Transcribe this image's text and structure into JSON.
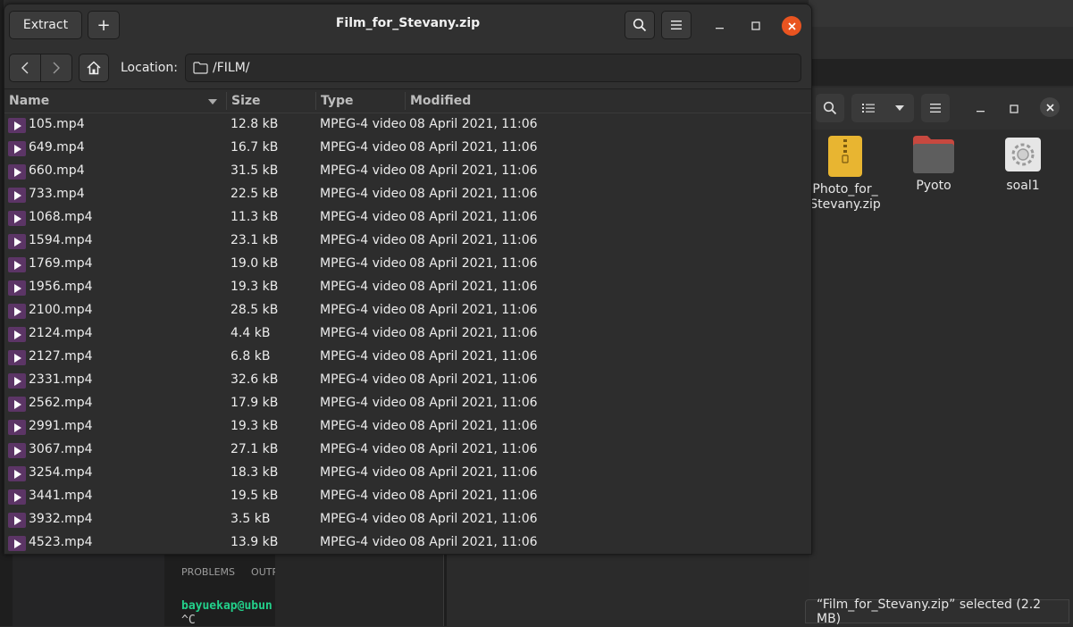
{
  "archive_window": {
    "title": "Film_for_Stevany.zip",
    "extract_label": "Extract",
    "add_label": "+",
    "location_label": "Location:",
    "location_path": "/FILM/",
    "columns": {
      "name": "Name",
      "size": "Size",
      "type": "Type",
      "modified": "Modified"
    },
    "files": [
      {
        "name": "105.mp4",
        "size": "12.8 kB",
        "type": "MPEG-4 video",
        "modified": "08 April 2021, 11:06"
      },
      {
        "name": "649.mp4",
        "size": "16.7 kB",
        "type": "MPEG-4 video",
        "modified": "08 April 2021, 11:06"
      },
      {
        "name": "660.mp4",
        "size": "31.5 kB",
        "type": "MPEG-4 video",
        "modified": "08 April 2021, 11:06"
      },
      {
        "name": "733.mp4",
        "size": "22.5 kB",
        "type": "MPEG-4 video",
        "modified": "08 April 2021, 11:06"
      },
      {
        "name": "1068.mp4",
        "size": "11.3 kB",
        "type": "MPEG-4 video",
        "modified": "08 April 2021, 11:06"
      },
      {
        "name": "1594.mp4",
        "size": "23.1 kB",
        "type": "MPEG-4 video",
        "modified": "08 April 2021, 11:06"
      },
      {
        "name": "1769.mp4",
        "size": "19.0 kB",
        "type": "MPEG-4 video",
        "modified": "08 April 2021, 11:06"
      },
      {
        "name": "1956.mp4",
        "size": "19.3 kB",
        "type": "MPEG-4 video",
        "modified": "08 April 2021, 11:06"
      },
      {
        "name": "2100.mp4",
        "size": "28.5 kB",
        "type": "MPEG-4 video",
        "modified": "08 April 2021, 11:06"
      },
      {
        "name": "2124.mp4",
        "size": "4.4 kB",
        "type": "MPEG-4 video",
        "modified": "08 April 2021, 11:06"
      },
      {
        "name": "2127.mp4",
        "size": "6.8 kB",
        "type": "MPEG-4 video",
        "modified": "08 April 2021, 11:06"
      },
      {
        "name": "2331.mp4",
        "size": "32.6 kB",
        "type": "MPEG-4 video",
        "modified": "08 April 2021, 11:06"
      },
      {
        "name": "2562.mp4",
        "size": "17.9 kB",
        "type": "MPEG-4 video",
        "modified": "08 April 2021, 11:06"
      },
      {
        "name": "2991.mp4",
        "size": "19.3 kB",
        "type": "MPEG-4 video",
        "modified": "08 April 2021, 11:06"
      },
      {
        "name": "3067.mp4",
        "size": "27.1 kB",
        "type": "MPEG-4 video",
        "modified": "08 April 2021, 11:06"
      },
      {
        "name": "3254.mp4",
        "size": "18.3 kB",
        "type": "MPEG-4 video",
        "modified": "08 April 2021, 11:06"
      },
      {
        "name": "3441.mp4",
        "size": "19.5 kB",
        "type": "MPEG-4 video",
        "modified": "08 April 2021, 11:06"
      },
      {
        "name": "3932.mp4",
        "size": "3.5 kB",
        "type": "MPEG-4 video",
        "modified": "08 April 2021, 11:06"
      },
      {
        "name": "4523.mp4",
        "size": "13.9 kB",
        "type": "MPEG-4 video",
        "modified": "08 April 2021, 11:06"
      }
    ]
  },
  "files_window": {
    "items": [
      {
        "label_line1": "Photo_for_",
        "label_line2": "Stevany.zip",
        "icon": "zip-archive-icon"
      },
      {
        "label_line1": "Pyoto",
        "label_line2": "",
        "icon": "folder-icon"
      },
      {
        "label_line1": "soal1",
        "label_line2": "",
        "icon": "executable-gear-icon"
      }
    ],
    "status": "“Film_for_Stevany.zip” selected  (2.2 MB)"
  },
  "vscode_panel": {
    "tabs": [
      "PROBLEMS",
      "OUTP"
    ],
    "prompt": "bayuekap@ubun",
    "ctrl_c": "^C"
  },
  "colors": {
    "accent_close": "#e95420",
    "video_icon": "#5c3566",
    "terminal_green": "#23d18b"
  }
}
